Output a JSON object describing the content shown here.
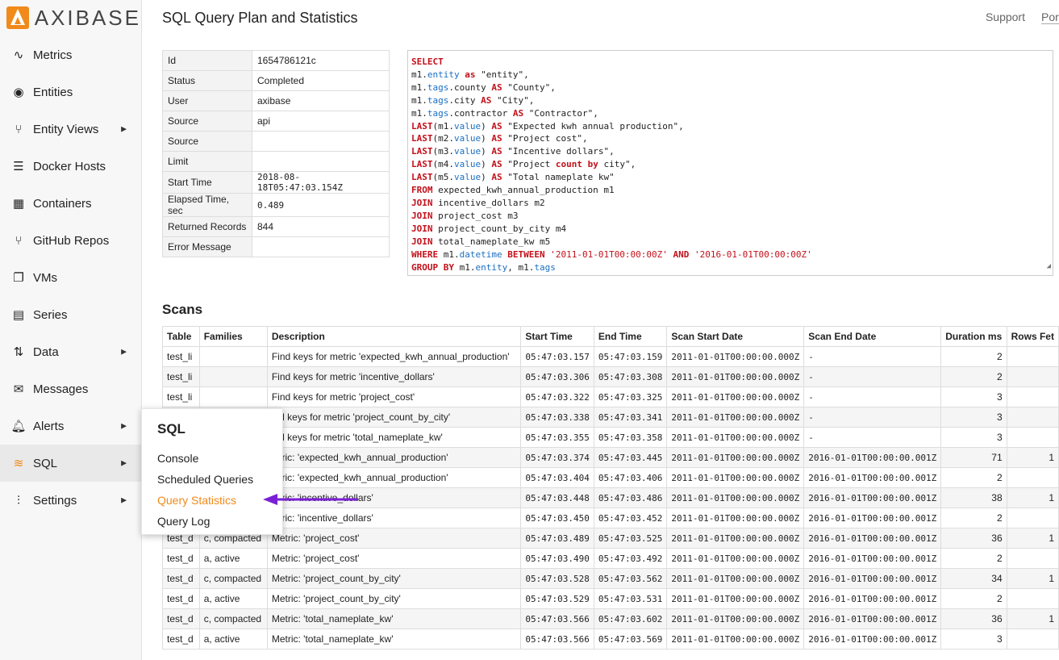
{
  "brand": {
    "name": "AXIBASE",
    "accent": "#f08a1a"
  },
  "sidebar": {
    "items": [
      {
        "label": "Metrics",
        "icon": "pulse-icon",
        "submenu": false
      },
      {
        "label": "Entities",
        "icon": "target-icon",
        "submenu": false
      },
      {
        "label": "Entity Views",
        "icon": "fork-icon",
        "submenu": true
      },
      {
        "label": "Docker Hosts",
        "icon": "docker-list-icon",
        "submenu": false
      },
      {
        "label": "Containers",
        "icon": "grid-icon",
        "submenu": false
      },
      {
        "label": "GitHub Repos",
        "icon": "branch-icon",
        "submenu": false
      },
      {
        "label": "VMs",
        "icon": "copy-icon",
        "submenu": false
      },
      {
        "label": "Series",
        "icon": "film-icon",
        "submenu": false
      },
      {
        "label": "Data",
        "icon": "sort-arrows-icon",
        "submenu": true
      },
      {
        "label": "Messages",
        "icon": "envelope-icon",
        "submenu": false
      },
      {
        "label": "Alerts",
        "icon": "bell-icon",
        "submenu": true
      },
      {
        "label": "SQL",
        "icon": "database-icon",
        "submenu": true
      },
      {
        "label": "Settings",
        "icon": "sliders-icon",
        "submenu": true
      }
    ]
  },
  "header": {
    "title": "SQL Query Plan and Statistics",
    "links": [
      "Support",
      "Por"
    ]
  },
  "info": {
    "rows": [
      {
        "key": "Id",
        "value": "1654786121c",
        "mono": false
      },
      {
        "key": "Status",
        "value": "Completed",
        "mono": false
      },
      {
        "key": "User",
        "value": "axibase",
        "mono": false
      },
      {
        "key": "Source",
        "value": "api",
        "mono": false
      },
      {
        "key": "Source",
        "value": "",
        "mono": false
      },
      {
        "key": "Limit",
        "value": "",
        "mono": false
      },
      {
        "key": "Start Time",
        "value": "2018-08-18T05:47:03.154Z",
        "mono": true
      },
      {
        "key": "Elapsed Time, sec",
        "value": "0.489",
        "mono": true
      },
      {
        "key": "Returned Records",
        "value": "844",
        "mono": false
      },
      {
        "key": "Error Message",
        "value": "",
        "mono": false
      }
    ]
  },
  "sql": {
    "lines": [
      [
        [
          "kw",
          "SELECT"
        ]
      ],
      [
        [
          "t",
          "m1."
        ],
        [
          "fn",
          "entity"
        ],
        [
          "t",
          " "
        ],
        [
          "kw",
          "as"
        ],
        [
          "t",
          " \"entity\","
        ]
      ],
      [
        [
          "t",
          "m1."
        ],
        [
          "fn",
          "tags"
        ],
        [
          "t",
          ".county "
        ],
        [
          "kw",
          "AS"
        ],
        [
          "t",
          " \"County\","
        ]
      ],
      [
        [
          "t",
          "m1."
        ],
        [
          "fn",
          "tags"
        ],
        [
          "t",
          ".city "
        ],
        [
          "kw",
          "AS"
        ],
        [
          "t",
          " \"City\","
        ]
      ],
      [
        [
          "t",
          "m1."
        ],
        [
          "fn",
          "tags"
        ],
        [
          "t",
          ".contractor "
        ],
        [
          "kw",
          "AS"
        ],
        [
          "t",
          " \"Contractor\","
        ]
      ],
      [
        [
          "kw",
          "LAST"
        ],
        [
          "t",
          "(m1."
        ],
        [
          "fn",
          "value"
        ],
        [
          "t",
          ") "
        ],
        [
          "kw",
          "AS"
        ],
        [
          "t",
          " \"Expected kwh annual production\","
        ]
      ],
      [
        [
          "kw",
          "LAST"
        ],
        [
          "t",
          "(m2."
        ],
        [
          "fn",
          "value"
        ],
        [
          "t",
          ") "
        ],
        [
          "kw",
          "AS"
        ],
        [
          "t",
          " \"Project cost\","
        ]
      ],
      [
        [
          "kw",
          "LAST"
        ],
        [
          "t",
          "(m3."
        ],
        [
          "fn",
          "value"
        ],
        [
          "t",
          ") "
        ],
        [
          "kw",
          "AS"
        ],
        [
          "t",
          " \"Incentive dollars\","
        ]
      ],
      [
        [
          "kw",
          "LAST"
        ],
        [
          "t",
          "(m4."
        ],
        [
          "fn",
          "value"
        ],
        [
          "t",
          ") "
        ],
        [
          "kw",
          "AS"
        ],
        [
          "t",
          " \"Project "
        ],
        [
          "kw",
          "count"
        ],
        [
          "t",
          " "
        ],
        [
          "kw",
          "by"
        ],
        [
          "t",
          " city\","
        ]
      ],
      [
        [
          "kw",
          "LAST"
        ],
        [
          "t",
          "(m5."
        ],
        [
          "fn",
          "value"
        ],
        [
          "t",
          ") "
        ],
        [
          "kw",
          "AS"
        ],
        [
          "t",
          " \"Total nameplate kw\""
        ]
      ],
      [
        [
          "kw",
          "FROM"
        ],
        [
          "t",
          " expected_kwh_annual_production m1"
        ]
      ],
      [
        [
          "kw",
          "JOIN"
        ],
        [
          "t",
          " incentive_dollars m2"
        ]
      ],
      [
        [
          "kw",
          "JOIN"
        ],
        [
          "t",
          " project_cost m3"
        ]
      ],
      [
        [
          "kw",
          "JOIN"
        ],
        [
          "t",
          " project_count_by_city m4"
        ]
      ],
      [
        [
          "kw",
          "JOIN"
        ],
        [
          "t",
          " total_nameplate_kw m5"
        ]
      ],
      [
        [
          "kw",
          "WHERE"
        ],
        [
          "t",
          " m1."
        ],
        [
          "fn",
          "datetime"
        ],
        [
          "t",
          " "
        ],
        [
          "kw",
          "BETWEEN"
        ],
        [
          "t",
          " "
        ],
        [
          "str",
          "'2011-01-01T00:00:00Z'"
        ],
        [
          "t",
          " "
        ],
        [
          "kw",
          "AND"
        ],
        [
          "t",
          " "
        ],
        [
          "str",
          "'2016-01-01T00:00:00Z'"
        ]
      ],
      [
        [
          "kw",
          "GROUP BY"
        ],
        [
          "t",
          " m1."
        ],
        [
          "fn",
          "entity"
        ],
        [
          "t",
          ", m1."
        ],
        [
          "fn",
          "tags"
        ]
      ]
    ]
  },
  "scans": {
    "title": "Scans",
    "columns": [
      "Table",
      "Families",
      "Description",
      "Start Time",
      "End Time",
      "Scan Start Date",
      "Scan End Date",
      "Duration ms",
      "Rows Fet"
    ],
    "rows": [
      [
        "test_li",
        "",
        "Find keys for metric 'expected_kwh_annual_production'",
        "05:47:03.157",
        "05:47:03.159",
        "2011-01-01T00:00:00.000Z",
        "-",
        "2",
        ""
      ],
      [
        "test_li",
        "",
        "Find keys for metric 'incentive_dollars'",
        "05:47:03.306",
        "05:47:03.308",
        "2011-01-01T00:00:00.000Z",
        "-",
        "2",
        ""
      ],
      [
        "test_li",
        "",
        "Find keys for metric 'project_cost'",
        "05:47:03.322",
        "05:47:03.325",
        "2011-01-01T00:00:00.000Z",
        "-",
        "3",
        ""
      ],
      [
        "",
        "",
        "ind keys for metric 'project_count_by_city'",
        "05:47:03.338",
        "05:47:03.341",
        "2011-01-01T00:00:00.000Z",
        "-",
        "3",
        ""
      ],
      [
        "",
        "",
        "ind keys for metric 'total_nameplate_kw'",
        "05:47:03.355",
        "05:47:03.358",
        "2011-01-01T00:00:00.000Z",
        "-",
        "3",
        ""
      ],
      [
        "",
        "",
        "letric: 'expected_kwh_annual_production'",
        "05:47:03.374",
        "05:47:03.445",
        "2011-01-01T00:00:00.000Z",
        "2016-01-01T00:00:00.001Z",
        "71",
        "1"
      ],
      [
        "",
        "",
        "letric: 'expected_kwh_annual_production'",
        "05:47:03.404",
        "05:47:03.406",
        "2011-01-01T00:00:00.000Z",
        "2016-01-01T00:00:00.001Z",
        "2",
        ""
      ],
      [
        "",
        "",
        "letric: 'incentive_dollars'",
        "05:47:03.448",
        "05:47:03.486",
        "2011-01-01T00:00:00.000Z",
        "2016-01-01T00:00:00.001Z",
        "38",
        "1"
      ],
      [
        "",
        "",
        "letric: 'incentive_dollars'",
        "05:47:03.450",
        "05:47:03.452",
        "2011-01-01T00:00:00.000Z",
        "2016-01-01T00:00:00.001Z",
        "2",
        ""
      ],
      [
        "test_d",
        "c, compacted",
        "Metric: 'project_cost'",
        "05:47:03.489",
        "05:47:03.525",
        "2011-01-01T00:00:00.000Z",
        "2016-01-01T00:00:00.001Z",
        "36",
        "1"
      ],
      [
        "test_d",
        "a, active",
        "Metric: 'project_cost'",
        "05:47:03.490",
        "05:47:03.492",
        "2011-01-01T00:00:00.000Z",
        "2016-01-01T00:00:00.001Z",
        "2",
        ""
      ],
      [
        "test_d",
        "c, compacted",
        "Metric: 'project_count_by_city'",
        "05:47:03.528",
        "05:47:03.562",
        "2011-01-01T00:00:00.000Z",
        "2016-01-01T00:00:00.001Z",
        "34",
        "1"
      ],
      [
        "test_d",
        "a, active",
        "Metric: 'project_count_by_city'",
        "05:47:03.529",
        "05:47:03.531",
        "2011-01-01T00:00:00.000Z",
        "2016-01-01T00:00:00.001Z",
        "2",
        ""
      ],
      [
        "test_d",
        "c, compacted",
        "Metric: 'total_nameplate_kw'",
        "05:47:03.566",
        "05:47:03.602",
        "2011-01-01T00:00:00.000Z",
        "2016-01-01T00:00:00.001Z",
        "36",
        "1"
      ],
      [
        "test_d",
        "a, active",
        "Metric: 'total_nameplate_kw'",
        "05:47:03.566",
        "05:47:03.569",
        "2011-01-01T00:00:00.000Z",
        "2016-01-01T00:00:00.001Z",
        "3",
        ""
      ]
    ]
  },
  "submenu": {
    "title": "SQL",
    "items": [
      "Console",
      "Scheduled Queries",
      "Query Statistics",
      "Query Log"
    ],
    "active_index": 2
  },
  "annotation": {
    "arrow_color": "#7a1fd6"
  }
}
